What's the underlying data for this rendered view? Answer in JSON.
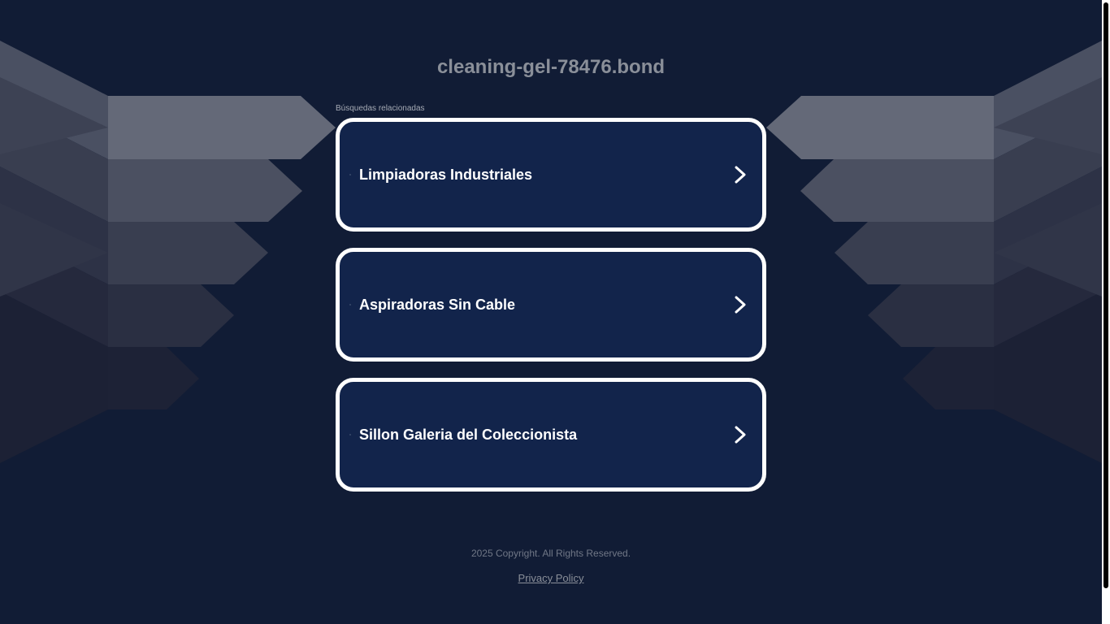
{
  "page": {
    "site_title": "cleaning-gel-78476.bond",
    "related_label": "Búsquedas relacionadas",
    "results": [
      {
        "label": "Limpiadoras Industriales",
        "icon": "chevron-right-icon"
      },
      {
        "label": "Aspiradoras Sin Cable",
        "icon": "chevron-right-icon"
      },
      {
        "label": "Sillon Galeria del Coleccionista",
        "icon": "chevron-right-icon"
      }
    ],
    "footer": {
      "copyright": "2025 Copyright. All Rights Reserved.",
      "privacy_link": "Privacy Policy"
    }
  },
  "colors": {
    "background": "#111c35",
    "card": "#12244b",
    "card_border": "#ffffff",
    "title": "#8a8f99",
    "text": "#ffffff"
  }
}
